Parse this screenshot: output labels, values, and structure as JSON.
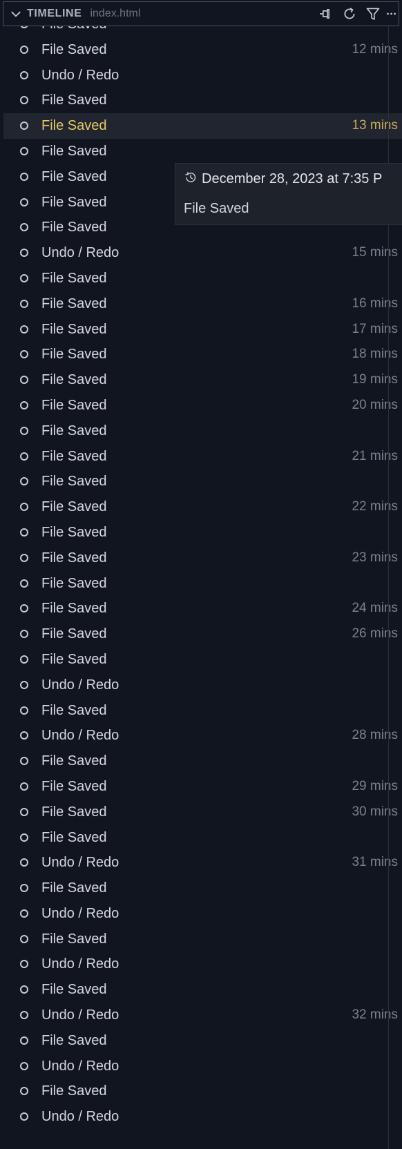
{
  "header": {
    "title": "TIMELINE",
    "file": "index.html",
    "actions": [
      {
        "name": "pin-icon"
      },
      {
        "name": "refresh-icon"
      },
      {
        "name": "filter-icon"
      },
      {
        "name": "more-icon"
      }
    ]
  },
  "tooltip": {
    "date": "December 28, 2023 at 7:35 P",
    "label": "File Saved"
  },
  "selected_index": 4,
  "items": [
    {
      "label": "File Saved",
      "time": ""
    },
    {
      "label": "File Saved",
      "time": "12 mins"
    },
    {
      "label": "Undo / Redo",
      "time": ""
    },
    {
      "label": "File Saved",
      "time": ""
    },
    {
      "label": "File Saved",
      "time": "13 mins"
    },
    {
      "label": "File Saved",
      "time": ""
    },
    {
      "label": "File Saved",
      "time": ""
    },
    {
      "label": "File Saved",
      "time": ""
    },
    {
      "label": "File Saved",
      "time": ""
    },
    {
      "label": "Undo / Redo",
      "time": "15 mins"
    },
    {
      "label": "File Saved",
      "time": ""
    },
    {
      "label": "File Saved",
      "time": "16 mins"
    },
    {
      "label": "File Saved",
      "time": "17 mins"
    },
    {
      "label": "File Saved",
      "time": "18 mins"
    },
    {
      "label": "File Saved",
      "time": "19 mins"
    },
    {
      "label": "File Saved",
      "time": "20 mins"
    },
    {
      "label": "File Saved",
      "time": ""
    },
    {
      "label": "File Saved",
      "time": "21 mins"
    },
    {
      "label": "File Saved",
      "time": ""
    },
    {
      "label": "File Saved",
      "time": "22 mins"
    },
    {
      "label": "File Saved",
      "time": ""
    },
    {
      "label": "File Saved",
      "time": "23 mins"
    },
    {
      "label": "File Saved",
      "time": ""
    },
    {
      "label": "File Saved",
      "time": "24 mins"
    },
    {
      "label": "File Saved",
      "time": "26 mins"
    },
    {
      "label": "File Saved",
      "time": ""
    },
    {
      "label": "Undo / Redo",
      "time": ""
    },
    {
      "label": "File Saved",
      "time": ""
    },
    {
      "label": "Undo / Redo",
      "time": "28 mins"
    },
    {
      "label": "File Saved",
      "time": ""
    },
    {
      "label": "File Saved",
      "time": "29 mins"
    },
    {
      "label": "File Saved",
      "time": "30 mins"
    },
    {
      "label": "File Saved",
      "time": ""
    },
    {
      "label": "Undo / Redo",
      "time": "31 mins"
    },
    {
      "label": "File Saved",
      "time": ""
    },
    {
      "label": "Undo / Redo",
      "time": ""
    },
    {
      "label": "File Saved",
      "time": ""
    },
    {
      "label": "Undo / Redo",
      "time": ""
    },
    {
      "label": "File Saved",
      "time": ""
    },
    {
      "label": "Undo / Redo",
      "time": "32 mins"
    },
    {
      "label": "File Saved",
      "time": ""
    },
    {
      "label": "Undo / Redo",
      "time": ""
    },
    {
      "label": "File Saved",
      "time": ""
    },
    {
      "label": "Undo / Redo",
      "time": ""
    }
  ]
}
